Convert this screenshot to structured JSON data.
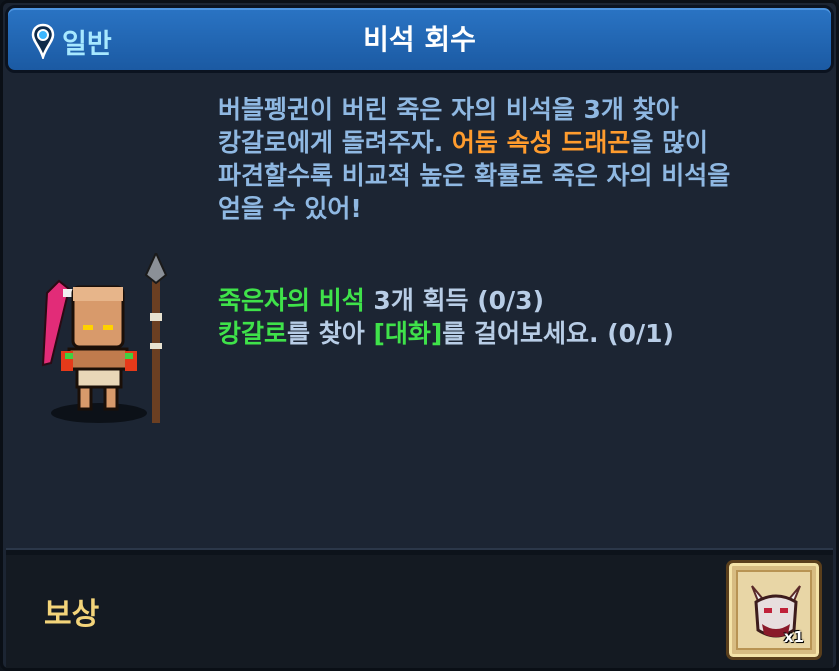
{
  "header": {
    "category": "일반",
    "title": "비석 회수",
    "category_icon": "map-pin-icon"
  },
  "description": {
    "part1": "버블펭귄이 버린 죽은 자의 비석을 3개 찾아",
    "part2": "캉갈로에게 돌려주자. ",
    "highlight": "어둠 속성 드래곤",
    "part3": "을 많이",
    "part4": "파견할수록 비교적 높은 확률로 죽은 자의 비석을",
    "part5": "얻을 수 있어!"
  },
  "objectives": [
    {
      "target": "죽은자의 비석",
      "text": " 3개 획득 (0/3)"
    },
    {
      "target": "캉갈로",
      "text_mid": "를 찾아 ",
      "target2": "[대화]",
      "text_end": "를 걸어보세요. (0/1)"
    }
  ],
  "npc": {
    "icon": "tribal-spear-warrior-icon"
  },
  "reward": {
    "label": "보상",
    "item_icon": "dragon-mask-icon",
    "quantity": "x1"
  },
  "colors": {
    "header_blue": "#2a74c4",
    "highlight_orange": "#ff9c2e",
    "objective_green": "#3fe24a",
    "reward_gold": "#f3d47a"
  }
}
